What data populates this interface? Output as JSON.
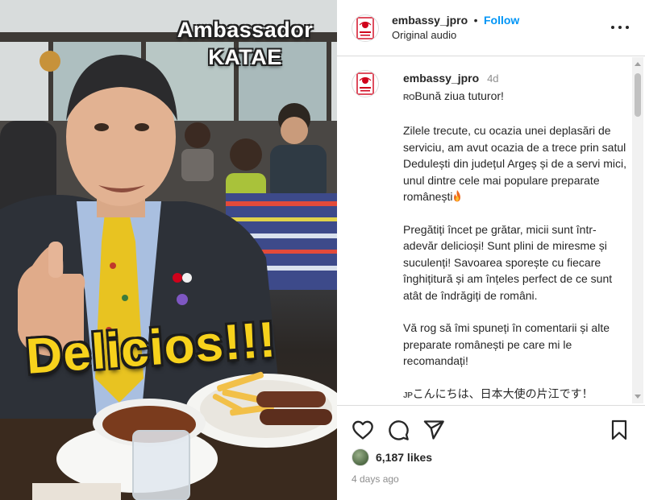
{
  "media": {
    "overlay_line1": "Ambassador",
    "overlay_line2": "KATAE",
    "overlay_big": "Delicios!!!"
  },
  "header": {
    "username": "embassy_jpro",
    "separator": "•",
    "follow_label": "Follow",
    "subtitle": "Original audio"
  },
  "caption": {
    "username": "embassy_jpro",
    "age": "4d",
    "ro_flag": "RO",
    "greeting": "Bună ziua tuturor!",
    "para1": "Zilele trecute, cu ocazia unei deplasări de serviciu, am avut ocazia de a trece prin satul Dedulești din județul Argeș și de a servi mici, unul dintre cele mai populare preparate românești",
    "para2": "Pregătiți încet pe grătar, micii sunt într-adevăr delicioși! Sunt plini de miresme și suculenți! Savoarea sporește cu fiecare înghițitură și am înțeles perfect de ce sunt atât de îndrăgiți de români.",
    "para3": "Vă rog să îmi spuneți în comentarii și alte preparate românești pe care mi le recomandați!",
    "jp_flag": "JP",
    "jp_line": "こんにちは、日本大使の片江です！"
  },
  "footer": {
    "likes": "6,187 likes",
    "time_ago": "4 days ago"
  },
  "icons": {
    "like": "heart-icon",
    "comment": "comment-icon",
    "share": "send-icon",
    "save": "bookmark-icon",
    "more": "more-options-icon"
  },
  "colors": {
    "accent": "#0095f6",
    "text": "#262626",
    "muted": "#8e8e8e",
    "divider": "#dbdbdb",
    "overlay_yellow": "#f7d21c",
    "emblem_red": "#d0021b"
  }
}
